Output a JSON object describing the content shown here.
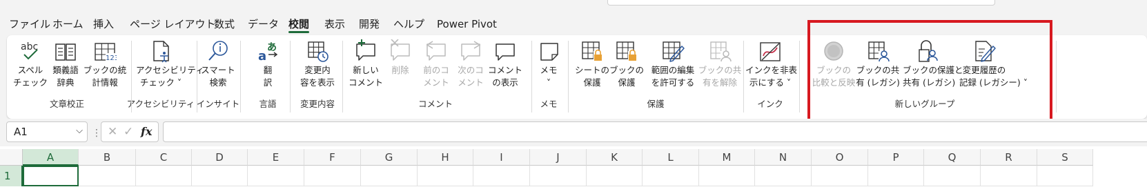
{
  "tabs": [
    {
      "label": "ファイル"
    },
    {
      "label": "ホーム"
    },
    {
      "label": "挿入"
    },
    {
      "label": "ページ レイアウト"
    },
    {
      "label": "数式"
    },
    {
      "label": "データ"
    },
    {
      "label": "校閲",
      "active": true
    },
    {
      "label": "表示"
    },
    {
      "label": "開発"
    },
    {
      "label": "ヘルプ"
    },
    {
      "label": "Power Pivot"
    }
  ],
  "groups": [
    {
      "label": "文章校正",
      "buttons": [
        {
          "icon": "spell-check-icon",
          "label": "スペル\nチェック"
        },
        {
          "icon": "thesaurus-icon",
          "label": "類義語\n辞典"
        },
        {
          "icon": "workbook-statistics-icon",
          "label": "ブックの統\n計情報"
        }
      ]
    },
    {
      "label": "アクセシビリティ",
      "buttons": [
        {
          "icon": "accessibility-check-icon",
          "label": "アクセシビリティ\nチェック ˅"
        }
      ]
    },
    {
      "label": "インサイト",
      "buttons": [
        {
          "icon": "smart-lookup-icon",
          "label": "スマート\n検索"
        }
      ]
    },
    {
      "label": "言語",
      "buttons": [
        {
          "icon": "translate-icon",
          "label": "翻\n訳"
        }
      ]
    },
    {
      "label": "変更内容",
      "buttons": [
        {
          "icon": "show-changes-icon",
          "label": "変更内\n容を表示"
        }
      ]
    },
    {
      "label": "コメント",
      "buttons": [
        {
          "icon": "new-comment-icon",
          "label": "新しい\nコメント"
        },
        {
          "icon": "delete-comment-icon",
          "label": "削除",
          "disabled": true
        },
        {
          "icon": "previous-comment-icon",
          "label": "前のコ\nメント",
          "disabled": true
        },
        {
          "icon": "next-comment-icon",
          "label": "次のコ\nメント",
          "disabled": true
        },
        {
          "icon": "show-comments-icon",
          "label": "コメント\nの表示"
        }
      ]
    },
    {
      "label": "メモ",
      "buttons": [
        {
          "icon": "notes-icon",
          "label": "メモ\n˅"
        }
      ]
    },
    {
      "label": "保護",
      "buttons": [
        {
          "icon": "protect-sheet-icon",
          "label": "シートの\n保護"
        },
        {
          "icon": "protect-workbook-icon",
          "label": "ブックの\n保護"
        },
        {
          "icon": "allow-edit-ranges-icon",
          "label": "範囲の編集\nを許可する"
        },
        {
          "icon": "unshare-workbook-icon",
          "label": "ブックの共\n有を解除",
          "disabled": true
        }
      ]
    },
    {
      "label": "インク",
      "buttons": [
        {
          "icon": "hide-ink-icon",
          "label": "インクを非表\n示にする ˅"
        }
      ]
    },
    {
      "label": "新しいグループ",
      "buttons": [
        {
          "icon": "compare-merge-icon",
          "label": "ブックの\n比較と反映",
          "disabled": true
        },
        {
          "icon": "share-workbook-legacy-icon",
          "label": "ブックの共\n有 (レガシ)"
        },
        {
          "icon": "protect-share-legacy-icon",
          "label": "ブックの保護と\n共有 (レガシ)"
        },
        {
          "icon": "track-changes-legacy-icon",
          "label": "変更履歴の\n記録 (レガシー) ˅"
        }
      ]
    }
  ],
  "formula_bar": {
    "name_box": "A1",
    "cancel_symbol": "✕",
    "enter_symbol": "✓",
    "function_symbol": "fx",
    "separator": "⋮",
    "value": ""
  },
  "columns": [
    "A",
    "B",
    "C",
    "D",
    "E",
    "F",
    "G",
    "H",
    "I",
    "J",
    "K",
    "L",
    "M",
    "N",
    "O",
    "P",
    "Q",
    "R",
    "S"
  ],
  "rows": [
    "1"
  ],
  "selected_cell": "A1",
  "colors": {
    "accent": "#1e6b3a",
    "highlight_box": "#d71920",
    "disabled_text": "#a8a8a8",
    "icon_blue": "#2b579a",
    "icon_orange": "#e8a135",
    "icon_red": "#c4314b"
  }
}
